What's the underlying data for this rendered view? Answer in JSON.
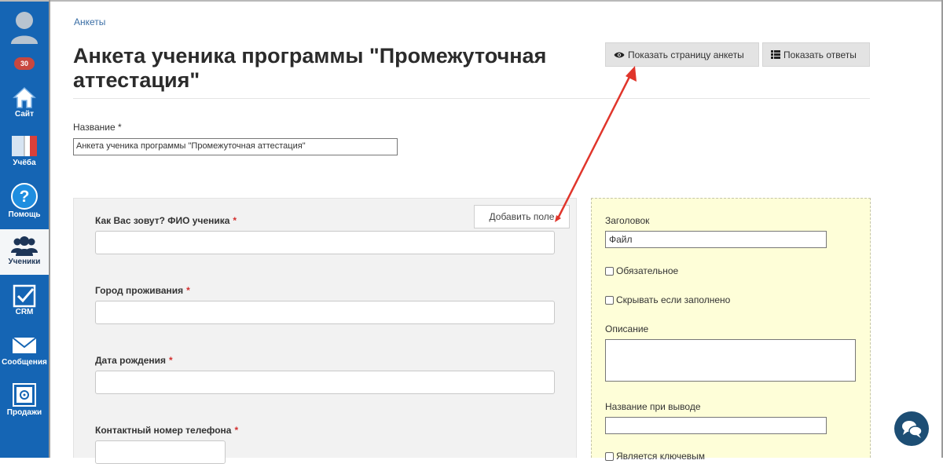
{
  "sidebar": {
    "badge": "30",
    "items": [
      {
        "label": "Сайт",
        "icon": "home-icon"
      },
      {
        "label": "Учёба",
        "icon": "book-icon"
      },
      {
        "label": "Помощь",
        "icon": "help-icon"
      },
      {
        "label": "Ученики",
        "icon": "users-icon"
      },
      {
        "label": "CRM",
        "icon": "checkbox-icon"
      },
      {
        "label": "Сообщения",
        "icon": "envelope-icon"
      },
      {
        "label": "Продажи",
        "icon": "safe-icon"
      }
    ],
    "active": "Ученики",
    "accent": "#1565b4"
  },
  "header": {
    "breadcrumb": "Анкеты",
    "title": "Анкета ученика программы \"Промежуточная аттестация\"",
    "show_page_label": "Показать страницу анкеты",
    "show_answers_label": "Показать ответы"
  },
  "name_field": {
    "label": "Название *",
    "value": "Анкета ученика программы \"Промежуточная аттестация\""
  },
  "form": {
    "add_field_label": "Добавить поле",
    "fields": [
      {
        "label": "Как Вас зовут? ФИО ученика",
        "required": "*"
      },
      {
        "label": "Город проживания",
        "required": "*"
      },
      {
        "label": "Дата рождения",
        "required": "*"
      },
      {
        "label": "Контактный номер телефона",
        "required": "*"
      }
    ]
  },
  "field_settings": {
    "heading_label": "Заголовок",
    "heading_value": "Файл",
    "required_label": "Обязательное",
    "hide_if_filled_label": "Скрывать если заполнено",
    "description_label": "Описание",
    "output_name_label": "Название при выводе",
    "key_label": "Является ключевым",
    "panel_color": "#fefed8"
  },
  "annotation_color": "#e0352b"
}
